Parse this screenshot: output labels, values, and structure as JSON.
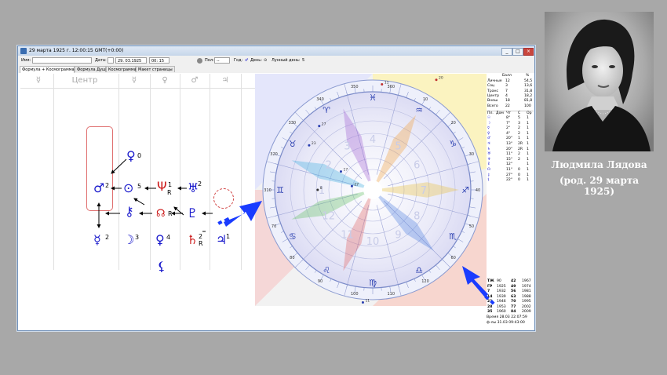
{
  "window": {
    "title": "29 марта 1925 г. 12:00:15 GMT(+0:00)",
    "buttons": [
      "_",
      "□",
      "×"
    ]
  },
  "toolbar": {
    "name_label": "Имя:",
    "name_value": "",
    "date_label": "Дата:",
    "date_value": "29. 03.1925",
    "time_value": "00: 15",
    "sex_label": "Пол:",
    "sex_value": "--",
    "year_label": "Год:",
    "day_label": "День:",
    "lunar_day_label": "Лунный день:",
    "lunar_day_value": "5"
  },
  "tabs": [
    "Формула + Космограмма",
    "Формула Души",
    "Космограмма",
    "Макет страницы"
  ],
  "formula": {
    "column_headers": [
      "☿",
      "Центр",
      "☿",
      "♀",
      "♂",
      "♃"
    ],
    "glyphs": [
      {
        "name": "venus-glyph",
        "symbol": "♀",
        "num": "0",
        "color": "#1a1acc"
      },
      {
        "name": "mars-glyph",
        "symbol": "♂",
        "num": "2",
        "color": "#1a1acc"
      },
      {
        "name": "sun-glyph",
        "symbol": "⊙",
        "num": "5",
        "color": "#1a1acc"
      },
      {
        "name": "neptune-glyph",
        "symbol": "Ψ",
        "num": "1",
        "sub": "R",
        "color": "#cc1a1a"
      },
      {
        "name": "uranus-glyph",
        "symbol": "♅",
        "num": "2",
        "color": "#1a1acc"
      },
      {
        "name": "chiron-glyph",
        "symbol": "⚷",
        "num": "",
        "color": "#1a1acc"
      },
      {
        "name": "node-glyph",
        "symbol": "☊",
        "num": "R",
        "color": "#cc1a1a"
      },
      {
        "name": "pluto-glyph",
        "symbol": "♇",
        "num": "",
        "color": "#1a1acc"
      },
      {
        "name": "mercury-glyph",
        "symbol": "☿",
        "num": "2",
        "color": "#1a1acc"
      },
      {
        "name": "moon-glyph",
        "symbol": "☽",
        "num": "3",
        "color": "#1a1acc"
      },
      {
        "name": "venus2-glyph",
        "symbol": "♀",
        "num": "4",
        "color": "#1a1acc"
      },
      {
        "name": "saturn-glyph",
        "symbol": "♄",
        "num": "2",
        "sub": "R",
        "color": "#cc1a1a"
      },
      {
        "name": "jupiter-glyph",
        "symbol": "♃",
        "num": "1",
        "color": "#1a1acc"
      },
      {
        "name": "lilith-glyph",
        "symbol": "⚸",
        "num": "",
        "color": "#1a1acc"
      }
    ]
  },
  "chart": {
    "degree_labels": [
      "70",
      "80",
      "90",
      "100",
      "110",
      "120",
      "60",
      "50",
      "40",
      "30",
      "20",
      "10",
      "360",
      "350",
      "340",
      "330",
      "320",
      "310"
    ],
    "sign_labels": [
      "♉",
      "♈",
      "♓",
      "♒",
      "♑",
      "♐",
      "♏",
      "♎",
      "♍",
      "♌",
      "♋",
      "♊"
    ],
    "house_numbers": [
      "1",
      "2",
      "3",
      "4",
      "5",
      "6",
      "7",
      "8",
      "9",
      "10",
      "11",
      "12"
    ],
    "planet_tags": [
      "27",
      "17",
      "8",
      "23",
      "27",
      "11",
      "11",
      "20",
      "5",
      "2"
    ]
  },
  "table": {
    "header": [
      "Балл",
      "%"
    ],
    "score_rows": [
      [
        "Личные",
        "12",
        "54,5"
      ],
      [
        "Соц",
        "3",
        "13,6"
      ],
      [
        "Транс",
        "7",
        "31,8"
      ],
      [
        "Центр",
        "4",
        "18,2"
      ],
      [
        "Внеш",
        "18",
        "81,8"
      ],
      [
        "Всего",
        "22",
        "100"
      ]
    ],
    "planet_header": [
      "Пл.",
      "Дом",
      "Чт",
      "С",
      "Ор"
    ],
    "planet_rows": [
      [
        "☉",
        "",
        "8°",
        "5",
        "1"
      ],
      [
        "☽",
        "",
        "7°",
        "3",
        "1"
      ],
      [
        "☿",
        "",
        "2°",
        "2",
        "1"
      ],
      [
        "♀",
        "",
        "4°",
        "2",
        "1"
      ],
      [
        "♂",
        "",
        "20°",
        "1",
        "1"
      ],
      [
        "♃",
        "",
        "13°",
        "2R",
        "1"
      ],
      [
        "♄",
        "",
        "20°",
        "2R",
        "1"
      ],
      [
        "♅",
        "",
        "11°",
        "2",
        "1"
      ],
      [
        "♆",
        "",
        "15°",
        "2",
        "1"
      ],
      [
        "♇",
        "",
        "12°",
        "",
        "1"
      ],
      [
        "☊",
        "",
        "11°",
        "0",
        "1"
      ],
      [
        "⚷",
        "",
        "27°",
        "0",
        "1"
      ],
      [
        "⚸",
        "",
        "22°",
        "0",
        "1"
      ]
    ],
    "cycle_rows": [
      [
        "ТЖ",
        "90",
        "42",
        "1967"
      ],
      [
        "ГР",
        "1925",
        "49",
        "1974"
      ],
      [
        "7",
        "1932",
        "56",
        "1981"
      ],
      [
        "14",
        "1939",
        "63",
        "1988"
      ],
      [
        "21",
        "1946",
        "70",
        "1995"
      ],
      [
        "28",
        "1953",
        "77",
        "2002"
      ],
      [
        "35",
        "1960",
        "84",
        "2009"
      ]
    ],
    "footer": [
      "Время 28.03 22:07:59",
      "ф-лы 31.03 09:43:00"
    ]
  },
  "photo_caption": {
    "name": "Людмила Лядова",
    "date": "(род. 29 марта 1925)"
  },
  "colors": {
    "glyph_blue": "#1a1acc",
    "glyph_red": "#cc1a1a",
    "arrow_blue": "#1a3cff",
    "window_border": "#6e8fb8",
    "background": "#a8a8a8"
  }
}
